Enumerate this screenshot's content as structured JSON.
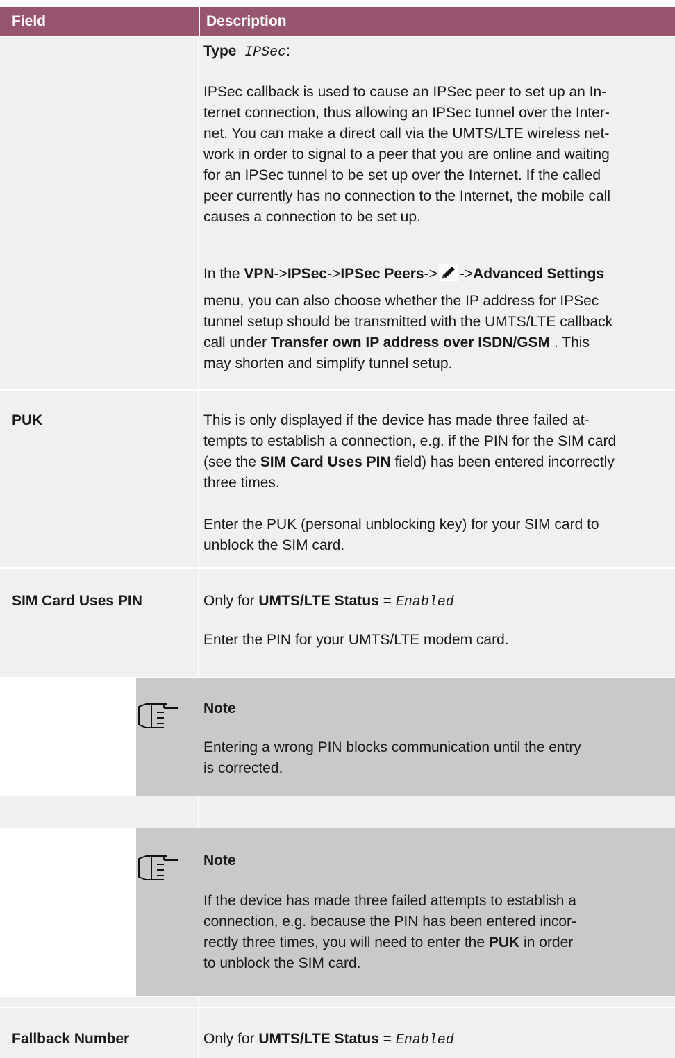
{
  "header": {
    "field": "Field",
    "description": "Description"
  },
  "ipsec": {
    "type_label": "Type",
    "type_value": "IPSec",
    "type_colon": ":",
    "lines": [
      "IPSec callback is used to cause an IPSec peer to set up an In-",
      "ternet connection, thus allowing an IPSec tunnel over the Inter-",
      "net. You can make a direct call via the UMTS/LTE wireless net-",
      "work in order to signal to a peer that you are online and waiting",
      "for an IPSec tunnel to be set up over the Internet. If the called",
      "peer currently has no connection to the Internet, the mobile call",
      "causes a connection to be set up."
    ],
    "menu_prefix": "In the",
    "menu_vpn": "VPN",
    "menu_arrow1": "->",
    "menu_ipsec": "IPSec",
    "menu_arrow2": "->",
    "menu_peers": "IPSec Peers",
    "menu_arrow3": "->",
    "menu_arrow4": "->",
    "menu_advanced": "Advanced Settings",
    "menu_line2": "menu, you can also choose whether the IP address for IPSec",
    "menu_line3": "tunnel setup should be transmitted with the UMTS/LTE callback",
    "menu_line4_pre": "call under",
    "menu_line4_bold": "Transfer own IP address over ISDN/GSM",
    "menu_line4_post": " . This",
    "menu_line5": "may shorten and simplify tunnel setup."
  },
  "puk": {
    "field": "PUK",
    "line1": "This is only displayed if the device has made three failed at-",
    "line2": "tempts to establish a connection, e.g. if the PIN for the SIM card",
    "line3_pre": "(see the",
    "line3_bold": "SIM Card Uses PIN",
    "line3_post": " field) has been entered incorrectly",
    "line4": "three times.",
    "line5": "Enter the PUK (personal unblocking key) for your SIM card to",
    "line6": "unblock the SIM card."
  },
  "sim": {
    "field": "SIM Card Uses PIN",
    "only_pre": "Only for",
    "only_bold": "UMTS/LTE Status",
    "only_eq": " = ",
    "only_val": "Enabled",
    "enter": "Enter the PIN for your UMTS/LTE modem card."
  },
  "note1": {
    "title": "Note",
    "line1": "Entering a wrong PIN blocks communication until the entry",
    "line2": "is corrected."
  },
  "note2": {
    "title": "Note",
    "line1": "If the device has made three failed attempts to establish a",
    "line2": "connection, e.g. because the PIN has been entered incor-",
    "line3_pre": "rectly three times, you will need to enter the ",
    "line3_bold": "PUK",
    "line3_post": " in order",
    "line4": "to unblock the SIM card."
  },
  "fallback": {
    "field": "Fallback Number",
    "only_pre": "Only for",
    "only_bold": "UMTS/LTE Status",
    "only_eq": " = ",
    "only_val": "Enabled"
  },
  "icons": {
    "note": "pointing-hand-icon",
    "edit": "pencil-icon"
  }
}
